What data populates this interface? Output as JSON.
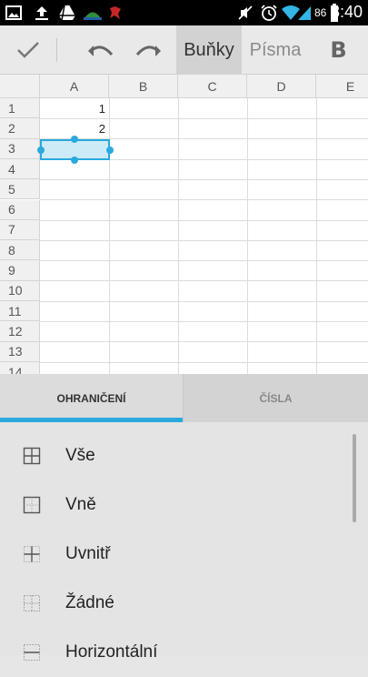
{
  "status_bar": {
    "battery_percent": "86",
    "time": "8:40"
  },
  "toolbar": {
    "tab_cells": "Buňky",
    "tab_fonts": "Písma",
    "tab_bold": "B"
  },
  "sheet": {
    "columns": [
      "A",
      "B",
      "C",
      "D",
      "E"
    ],
    "rows": [
      "1",
      "2",
      "3",
      "4",
      "5",
      "6",
      "7",
      "8",
      "9",
      "10",
      "11",
      "12",
      "13",
      "14"
    ],
    "cells": {
      "A1": "1",
      "A2": "2"
    },
    "selected_cell": "A3"
  },
  "panel": {
    "tab_borders": "OHRANIČENÍ",
    "tab_numbers": "ČÍSLA",
    "options": [
      "Vše",
      "Vně",
      "Uvnitř",
      "Žádné",
      "Horizontální"
    ]
  },
  "colors": {
    "accent": "#2aa9de",
    "selection_fill": "#cdebf7"
  }
}
